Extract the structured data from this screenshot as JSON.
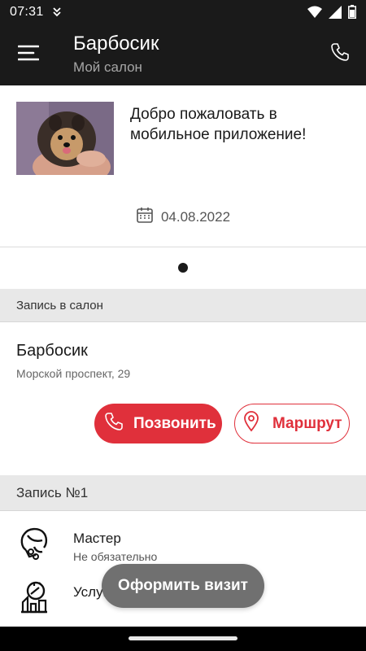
{
  "status_bar": {
    "time": "07:31",
    "icons": [
      "notification-icon",
      "wifi-icon",
      "signal-icon",
      "battery-icon"
    ]
  },
  "app_bar": {
    "title": "Барбосик",
    "subtitle": "Мой салон",
    "menu_icon": "menu-icon",
    "phone_icon": "phone-icon"
  },
  "promo": {
    "image": "dog-photo",
    "text": "Добро пожаловать в мобильное приложение!",
    "date": "04.08.2022",
    "pager_count": 1,
    "pager_active": 1
  },
  "salon_section": {
    "header": "Запись в салон",
    "name": "Барбосик",
    "address": "Морской проспект, 29",
    "call_label": "Позвонить",
    "route_label": "Маршрут"
  },
  "record_section": {
    "header": "Запись №1",
    "items": [
      {
        "title": "Мастер",
        "subtitle": "Не обязательно",
        "icon": "master-icon"
      },
      {
        "title": "Услуги",
        "subtitle": "",
        "icon": "services-icon"
      }
    ]
  },
  "fab": {
    "label": "Оформить визит"
  },
  "colors": {
    "app_bar": "#1a1a1a",
    "accent": "#e0303b",
    "section_header": "#e8e8e8",
    "fab": "#707070"
  }
}
